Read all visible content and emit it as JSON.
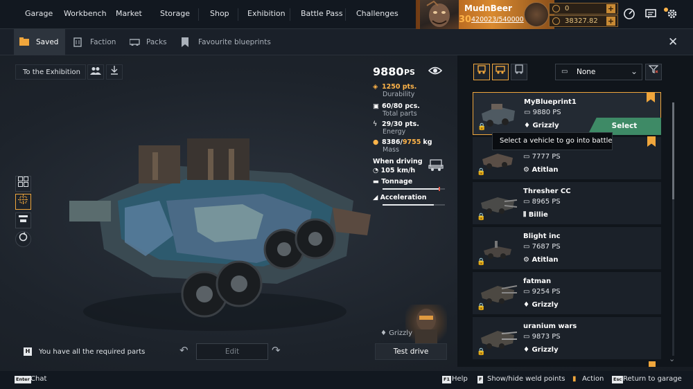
{
  "nav": {
    "items": [
      "Garage",
      "Workbench",
      "Market",
      "Storage",
      "Shop",
      "Exhibition",
      "Battle Pass",
      "Challenges"
    ]
  },
  "player": {
    "name": "MudnBeer",
    "level": "30",
    "xp": "420023/540000"
  },
  "currency": {
    "coins": "0",
    "credits": "38327.82",
    "plus": "+"
  },
  "tabs": {
    "saved": "Saved",
    "faction": "Faction",
    "packs": "Packs",
    "favourite": "Favourite blueprints"
  },
  "toolbar": {
    "to_exhibition": "To the Exhibition",
    "close": "✕"
  },
  "stats": {
    "ps": "9880",
    "ps_unit": "PS",
    "durability_value": "1250 pts.",
    "durability_label": "Durability",
    "parts_value": "60/80 pcs.",
    "parts_label": "Total parts",
    "energy_value": "29/30 pts.",
    "energy_label": "Energy",
    "mass_value": "8386",
    "mass_max": "9755",
    "mass_unit": "kg",
    "mass_label": "Mass",
    "when_driving": "When driving",
    "speed": "105 km/h",
    "tonnage_label": "Tonnage",
    "tonnage_fill": 0.92,
    "acceleration_label": "Acceleration",
    "acceleration_fill": 0.82
  },
  "filter": {
    "faction_value": "None"
  },
  "blueprints": [
    {
      "name": "MyBlueprint1",
      "ps": "9880 PS",
      "faction": "Grizzly"
    },
    {
      "name": "",
      "ps": "7777 PS",
      "faction": "Atitlan"
    },
    {
      "name": "Thresher CC",
      "ps": "8965 PS",
      "faction": "Billie"
    },
    {
      "name": "Blight inc",
      "ps": "7687 PS",
      "faction": "Atitlan"
    },
    {
      "name": "fatman",
      "ps": "9254 PS",
      "faction": "Grizzly"
    },
    {
      "name": "uranium wars",
      "ps": "9873 PS",
      "faction": "Grizzly"
    }
  ],
  "select_label": "Select",
  "tooltip": "Select a vehicle to go into battle",
  "bottom": {
    "required_key": "H",
    "required_text": "You have all the required parts",
    "edit": "Edit",
    "driver_faction": "Grizzly",
    "test_drive": "Test drive"
  },
  "footer": {
    "chat_key": "Enter",
    "chat": "Chat",
    "help_key": "F1",
    "help": "Help",
    "weld_key": "F",
    "weld": "Show/hide weld points",
    "action": "Action",
    "return_key": "Esc",
    "return": "Return to garage"
  },
  "colors": {
    "accent": "#f0a63c",
    "select_green": "#3e8a66",
    "bg": "#1d232b"
  }
}
